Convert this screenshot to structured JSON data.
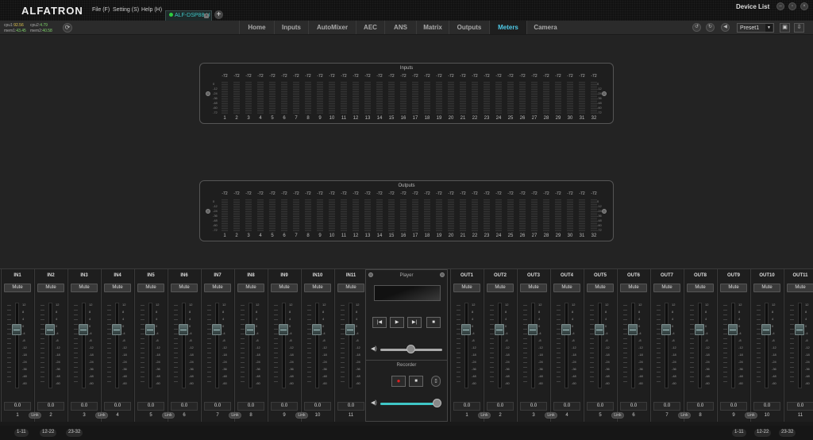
{
  "app": {
    "logo": "ALFATRON",
    "menus": [
      "File (F)",
      "Setting (S)",
      "Help (H)"
    ],
    "device_tab": "ALF-DSP88-U",
    "add_tab": "+",
    "device_list": "Device List"
  },
  "stats": {
    "cpu1_label": "cpu1",
    "cpu1": "92.56",
    "cpu2_label": "cpu2",
    "cpu2": "4.79",
    "mem1_label": "mem1",
    "mem1": "43.45",
    "mem2_label": "mem2",
    "mem2": "40.58"
  },
  "nav": {
    "tabs": [
      "Home",
      "Inputs",
      "AutoMixer",
      "AEC",
      "ANS",
      "Matrix",
      "Outputs",
      "Meters",
      "Camera"
    ],
    "active": "Meters"
  },
  "preset": {
    "value": "Preset1"
  },
  "meters": {
    "inputs_title": "Inputs",
    "outputs_title": "Outputs",
    "peak": "-72",
    "scale": [
      "0",
      "-12",
      "-24",
      "-36",
      "-48",
      "-60",
      "-72"
    ],
    "inputs_count": 32,
    "outputs_count": 32
  },
  "mixer": {
    "inputs": [
      "IN1",
      "IN2",
      "IN3",
      "IN4",
      "IN5",
      "IN6",
      "IN7",
      "IN8",
      "IN9",
      "IN10",
      "IN11"
    ],
    "outputs": [
      "OUT1",
      "OUT2",
      "OUT3",
      "OUT4",
      "OUT5",
      "OUT6",
      "OUT7",
      "OUT8",
      "OUT9",
      "OUT10",
      "OUT11"
    ],
    "mute_label": "Mute",
    "value": "0.0",
    "link_label": "Link",
    "fader_scale": [
      "12",
      "8",
      "4",
      "0",
      "-4",
      "-8",
      "-12",
      "-18",
      "-24",
      "-36",
      "-48",
      "-60"
    ]
  },
  "player": {
    "title": "Player",
    "recorder_title": "Recorder"
  },
  "pages": {
    "left": [
      "1-11",
      "12-22",
      "23-32"
    ],
    "right": [
      "1-11",
      "12-22",
      "23-32"
    ]
  },
  "colors": {
    "accent": "#4fc9e6",
    "record": "#e02020"
  }
}
